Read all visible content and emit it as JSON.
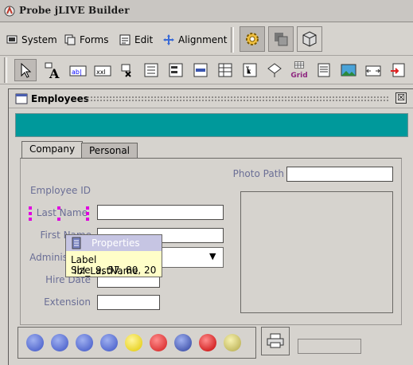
{
  "window": {
    "title": "Probe jLIVE Builder"
  },
  "menu": {
    "system": "System",
    "forms": "Forms",
    "edit": "Edit",
    "alignment": "Alignment"
  },
  "toolbar": {
    "grid_label": "Grid"
  },
  "form": {
    "title": "Employees",
    "close_glyph": "☒",
    "tabs": [
      {
        "label": "Company"
      },
      {
        "label": "Personal"
      }
    ],
    "fields": {
      "photo_path": "Photo Path",
      "employee_id": "Employee ID",
      "last_name": "Last Name",
      "first_name": "First Name",
      "admin": "Adminis",
      "hire_date": "Hire Date",
      "extension": "Extension"
    },
    "combo_arrow": "▼"
  },
  "tooltip": {
    "title": "Properties",
    "label_key": "Label",
    "label_value": "lbl_LastName",
    "size_key": "Size",
    "size_value": "9, 57, 80, 20"
  },
  "colors": {
    "teal": "#00999b",
    "label": "#6b6f96",
    "handle": "#e000e0"
  }
}
